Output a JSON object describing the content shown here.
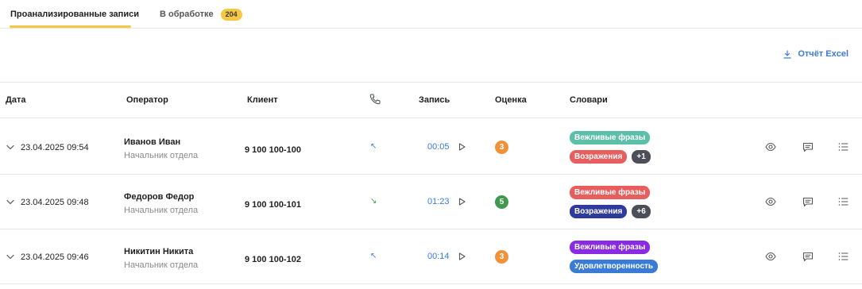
{
  "tabs": {
    "analyzed_label": "Проанализированные записи",
    "processing_label": "В обработке",
    "processing_count": "204"
  },
  "toolbar": {
    "excel_label": "Отчёт Excel"
  },
  "columns": {
    "date": "Дата",
    "operator": "Оператор",
    "client": "Клиент",
    "call_icon": "phone-icon",
    "record": "Запись",
    "score": "Оценка",
    "dictionaries": "Словари"
  },
  "colors": {
    "accent_yellow": "#f5c842",
    "link_blue": "#3a7bd5",
    "score_orange": "#f0923a",
    "score_green": "#3f9a4e"
  },
  "rows": [
    {
      "date": "23.04.2025 09:54",
      "operator_name": "Иванов Иван",
      "operator_role": "Начальник отдела",
      "client": "9 100 100-100",
      "direction": "incoming",
      "duration": "00:05",
      "score": "3",
      "tags": [
        {
          "label": "Вежливые фразы",
          "color": "#5cbfa7"
        },
        {
          "label": "Возражения",
          "color": "#e85d5d"
        }
      ],
      "more": "+1"
    },
    {
      "date": "23.04.2025 09:48",
      "operator_name": "Федоров Федор",
      "operator_role": "Начальник отдела",
      "client": "9 100 100-101",
      "direction": "outgoing",
      "duration": "01:23",
      "score": "5",
      "tags": [
        {
          "label": "Вежливые фразы",
          "color": "#e85d5d"
        },
        {
          "label": "Возражения",
          "color": "#2f3b9c"
        }
      ],
      "more": "+6"
    },
    {
      "date": "23.04.2025 09:46",
      "operator_name": "Никитин Никита",
      "operator_role": "Начальник отдела",
      "client": "9 100 100-102",
      "direction": "incoming",
      "duration": "00:14",
      "score": "3",
      "tags": [
        {
          "label": "Вежливые фразы",
          "color": "#8a2be2"
        },
        {
          "label": "Удовлетворенность",
          "color": "#3a7bd5"
        }
      ],
      "more": ""
    }
  ]
}
